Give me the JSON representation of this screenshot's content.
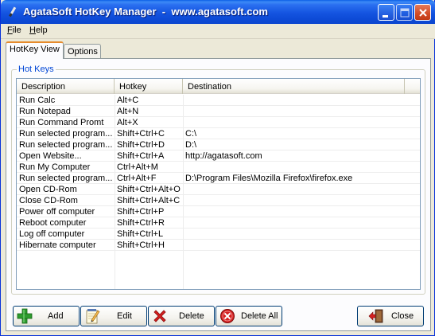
{
  "window": {
    "title": "AgataSoft HotKey Manager  -  www.agatasoft.com"
  },
  "menu": [
    {
      "key": "F",
      "rest": "ile"
    },
    {
      "key": "H",
      "rest": "elp"
    }
  ],
  "tabs": {
    "hotkey_view": "HotKey View",
    "options": "Options"
  },
  "group": {
    "label": "Hot Keys"
  },
  "table": {
    "columns": [
      "Description",
      "Hotkey",
      "Destination"
    ],
    "rows": [
      [
        "Run Calc",
        "Alt+C",
        ""
      ],
      [
        "Run Notepad",
        "Alt+N",
        ""
      ],
      [
        "Run Command Promt",
        "Alt+X",
        ""
      ],
      [
        "Run selected program...",
        "Shift+Ctrl+C",
        "C:\\"
      ],
      [
        "Run selected program...",
        "Shift+Ctrl+D",
        "D:\\"
      ],
      [
        "Open Website...",
        "Shift+Ctrl+A",
        "http://agatasoft.com"
      ],
      [
        "Run My Computer",
        "Ctrl+Alt+M",
        ""
      ],
      [
        "Run selected program...",
        "Ctrl+Alt+F",
        "D:\\Program Files\\Mozilla Firefox\\firefox.exe"
      ],
      [
        "Open CD-Rom",
        "Shift+Ctrl+Alt+O",
        ""
      ],
      [
        "Close CD-Rom",
        "Shift+Ctrl+Alt+C",
        ""
      ],
      [
        "Power off computer",
        "Shift+Ctrl+P",
        ""
      ],
      [
        "Reboot computer",
        "Shift+Ctrl+R",
        ""
      ],
      [
        "Log off computer",
        "Shift+Ctrl+L",
        ""
      ],
      [
        "Hibernate computer",
        "Shift+Ctrl+H",
        ""
      ]
    ]
  },
  "buttons": {
    "add": "Add",
    "edit": "Edit",
    "delete": "Delete",
    "delete_all": "Delete All",
    "close": "Close"
  },
  "icons": {
    "add": "green-plus-icon",
    "edit": "notepad-pencil-icon",
    "delete": "red-x-icon",
    "delete_all": "red-circle-x-icon",
    "close": "exit-door-icon"
  }
}
